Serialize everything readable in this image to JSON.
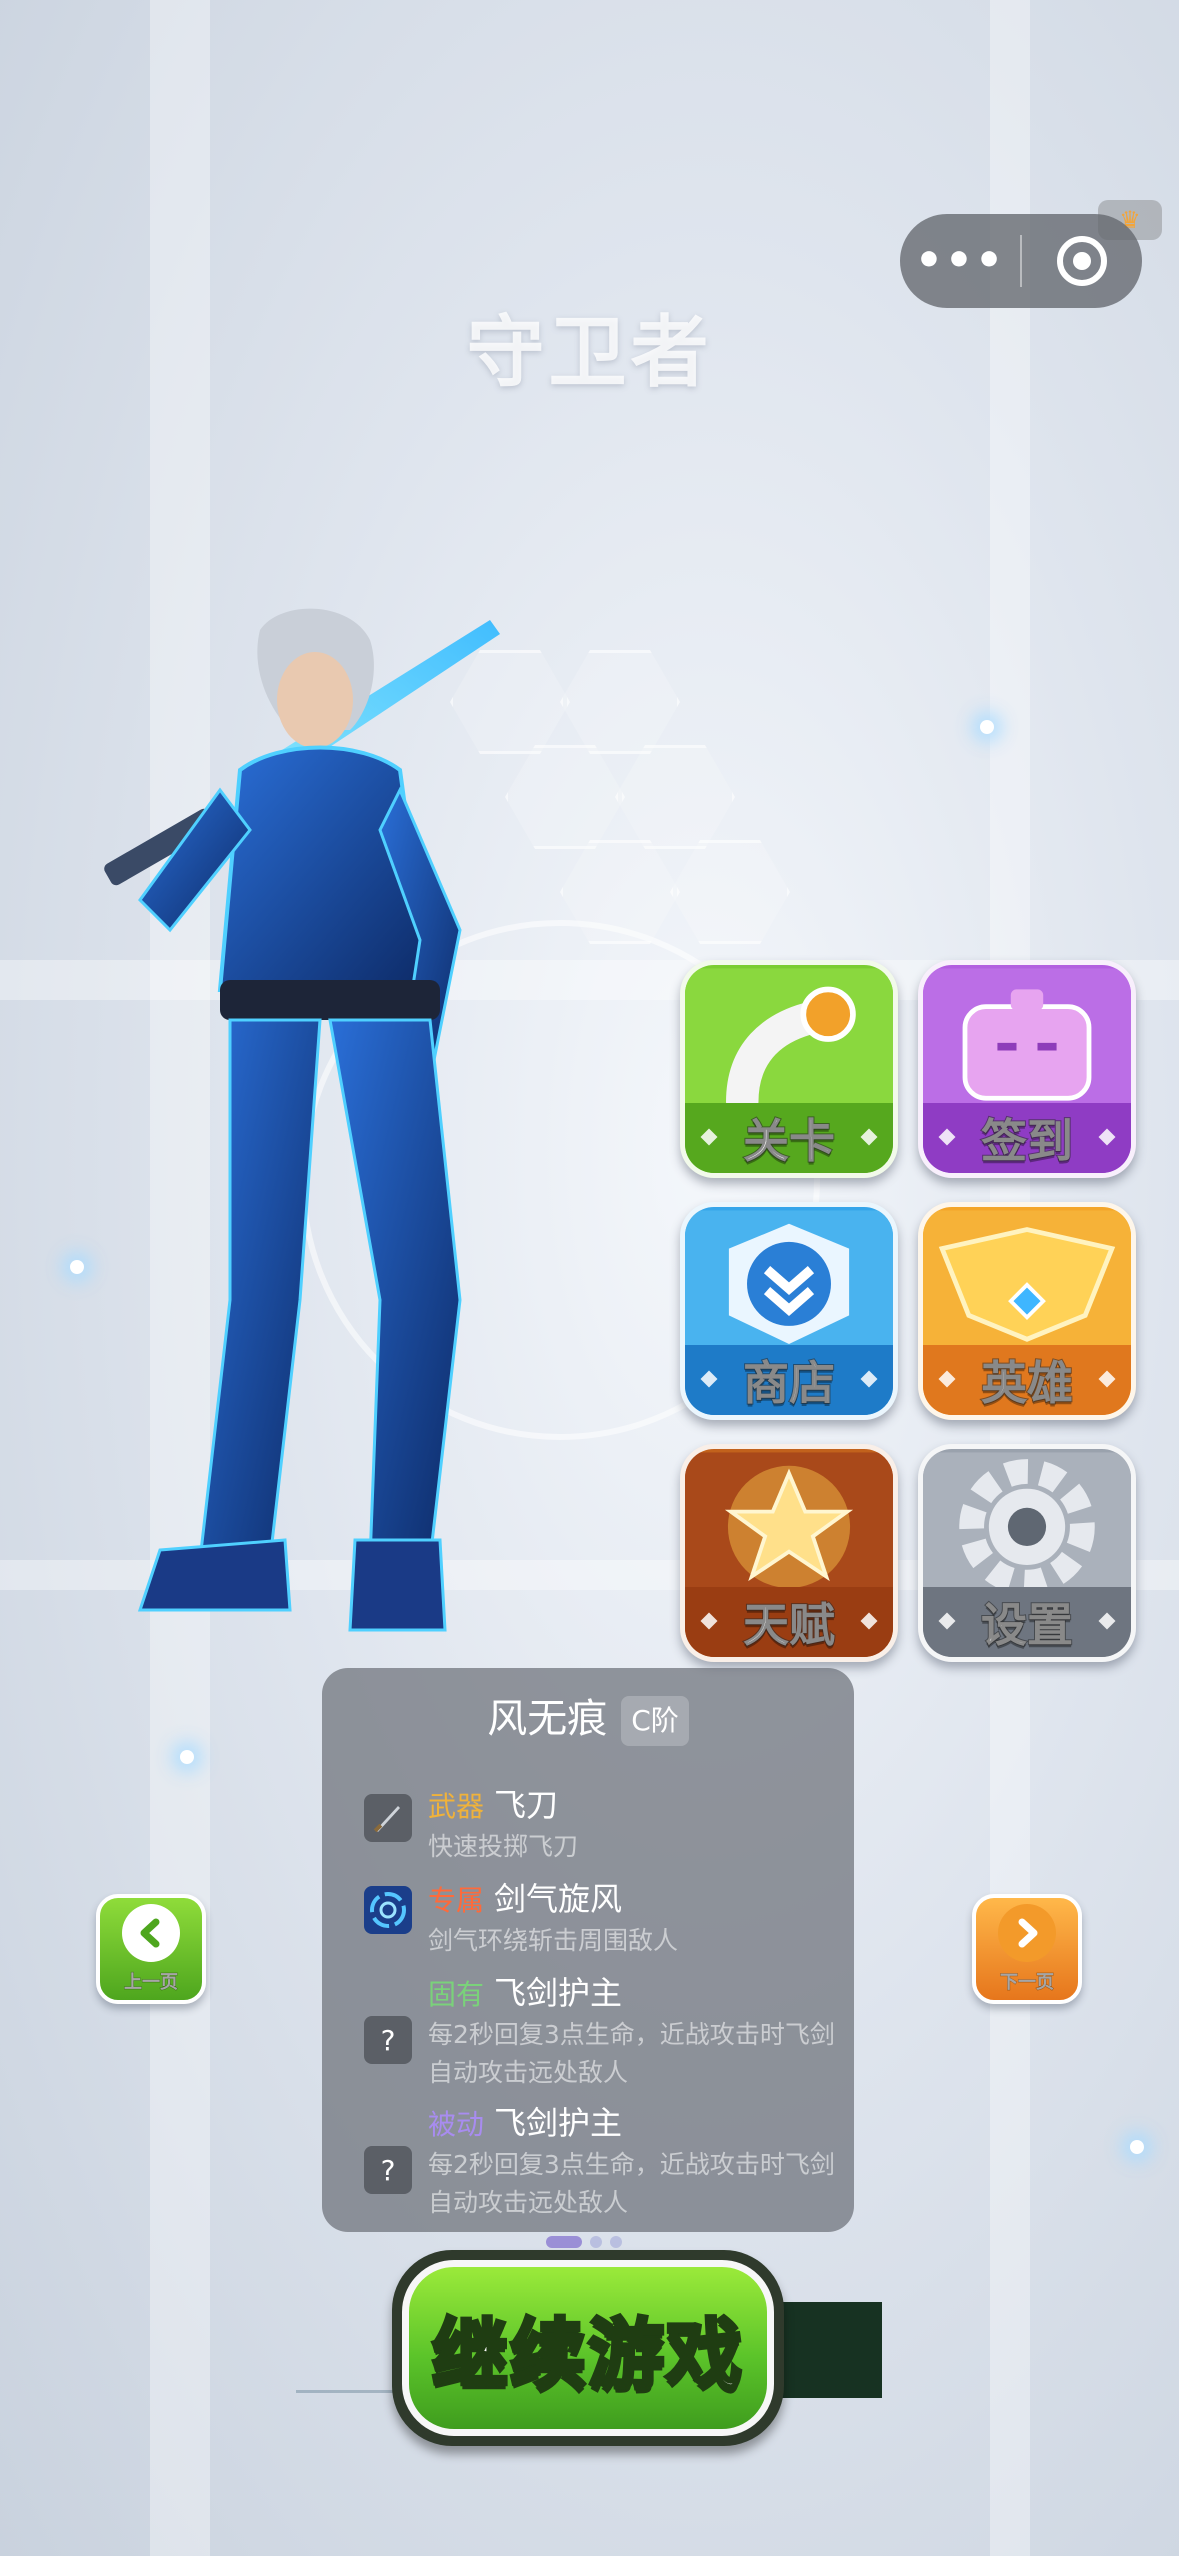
{
  "page": {
    "title": "守卫者"
  },
  "capsule": {
    "more_label": "•••"
  },
  "menu": {
    "items": [
      {
        "label": "关卡",
        "icon": "pipe-icon",
        "color": "#6cc429"
      },
      {
        "label": "签到",
        "icon": "robot-icon",
        "color": "#b25ee0"
      },
      {
        "label": "商店",
        "icon": "shop-badge-icon",
        "color": "#35a5ea"
      },
      {
        "label": "英雄",
        "icon": "winged-crest-icon",
        "color": "#f4a528"
      },
      {
        "label": "天赋",
        "icon": "golden-star-icon",
        "color": "#c2621c"
      },
      {
        "label": "设置",
        "icon": "gear-icon",
        "color": "#9aa2ad"
      }
    ]
  },
  "hero": {
    "name": "风无痕",
    "grade": "C阶",
    "skills": [
      {
        "tag": "武器",
        "tag_color": "#f0b23a",
        "name": "飞刀",
        "desc": "快速投掷飞刀",
        "icon": "flying-knife-icon"
      },
      {
        "tag": "专属",
        "tag_color": "#ff6a3a",
        "name": "剑气旋风",
        "desc": "剑气环绕斩击周围敌人",
        "icon": "whirlwind-icon"
      },
      {
        "tag": "固有",
        "tag_color": "#7ad27a",
        "name": "飞剑护主",
        "desc": "每2秒回复3点生命，近战攻击时飞剑自动攻击远处敌人",
        "icon": "question-icon",
        "icon_text": "?"
      },
      {
        "tag": "被动",
        "tag_color": "#a88cf0",
        "name": "飞剑护主",
        "desc": "每2秒回复3点生命，近战攻击时飞剑自动攻击远处敌人",
        "icon": "question-icon",
        "icon_text": "?"
      }
    ]
  },
  "nav": {
    "prev_label": "上一页",
    "next_label": "下一页"
  },
  "continue": {
    "label": "继续游戏"
  }
}
